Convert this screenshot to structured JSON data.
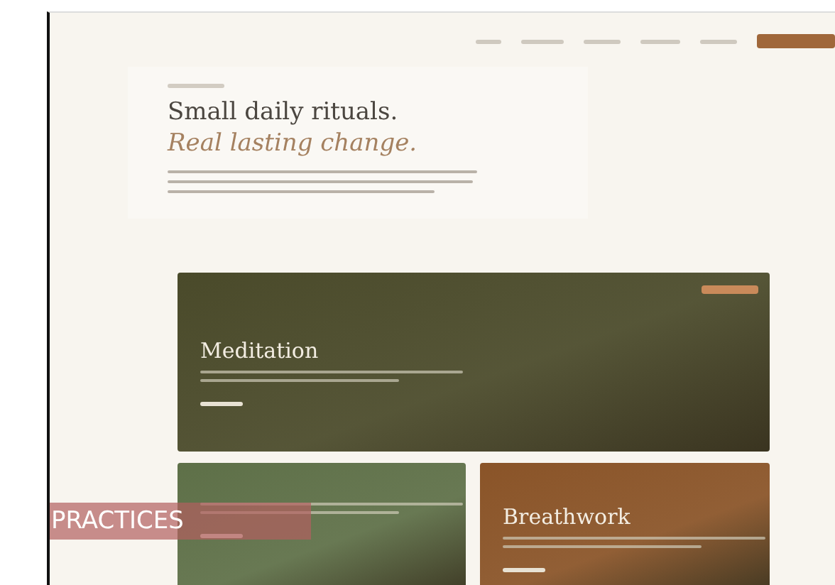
{
  "hero": {
    "title": "Small daily rituals.",
    "subtitle": "Real lasting change."
  },
  "practices": [
    {
      "title": "Meditation",
      "color": "#4a4a2a",
      "featured": true
    },
    {
      "color": "#5e7048",
      "featured": false
    },
    {
      "title": "Breathwork",
      "color": "#8a5428",
      "featured": false
    }
  ],
  "section_label": "PRACTICES"
}
